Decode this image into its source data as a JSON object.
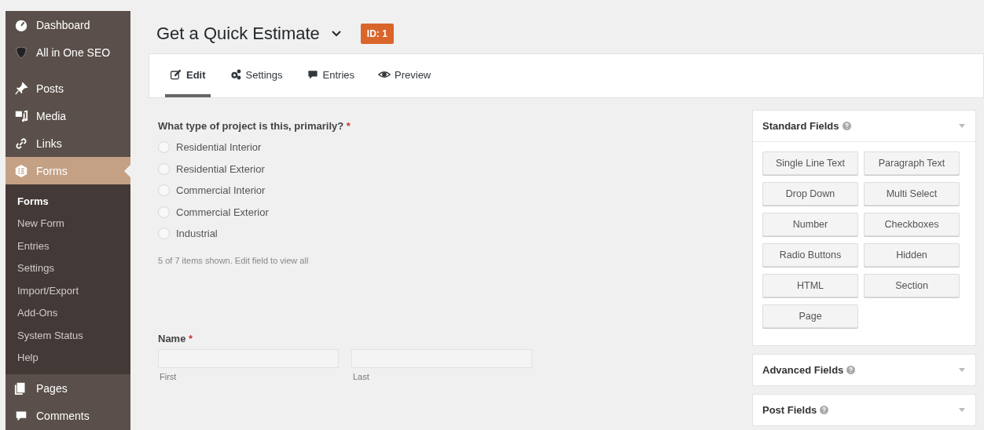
{
  "sidebar": {
    "items": [
      {
        "label": "Dashboard",
        "selected": false
      },
      {
        "label": "All in One SEO",
        "selected": false
      },
      {
        "label": "Posts",
        "selected": false
      },
      {
        "label": "Media",
        "selected": false
      },
      {
        "label": "Links",
        "selected": false
      },
      {
        "label": "Forms",
        "selected": true,
        "children": [
          {
            "label": "Forms",
            "selected": true
          },
          {
            "label": "New Form",
            "selected": false
          },
          {
            "label": "Entries",
            "selected": false
          },
          {
            "label": "Settings",
            "selected": false
          },
          {
            "label": "Import/Export",
            "selected": false
          },
          {
            "label": "Add-Ons",
            "selected": false
          },
          {
            "label": "System Status",
            "selected": false
          },
          {
            "label": "Help",
            "selected": false
          }
        ]
      },
      {
        "label": "Pages",
        "selected": false
      },
      {
        "label": "Comments",
        "selected": false
      }
    ]
  },
  "header": {
    "title": "Get a Quick Estimate",
    "badge": "ID: 1"
  },
  "tabs": [
    {
      "label": "Edit",
      "selected": true
    },
    {
      "label": "Settings",
      "selected": false
    },
    {
      "label": "Entries",
      "selected": false
    },
    {
      "label": "Preview",
      "selected": false
    }
  ],
  "form": {
    "question": {
      "label": "What type of project is this, primarily?",
      "required": "*",
      "options": [
        {
          "label": "Residential Interior",
          "selected": false
        },
        {
          "label": "Residential Exterior",
          "selected": false
        },
        {
          "label": "Commercial Interior",
          "selected": false
        },
        {
          "label": "Commercial Exterior",
          "selected": false
        },
        {
          "label": "Industrial",
          "selected": false
        }
      ],
      "note": "5 of 7 items shown. Edit field to view all"
    },
    "name": {
      "label": "Name",
      "required": "*",
      "fields": [
        {
          "sublabel": "First"
        },
        {
          "sublabel": "Last"
        }
      ]
    }
  },
  "panels": [
    {
      "title": "Standard Fields",
      "buttons": [
        "Single Line Text",
        "Paragraph Text",
        "Drop Down",
        "Multi Select",
        "Number",
        "Checkboxes",
        "Radio Buttons",
        "Hidden",
        "HTML",
        "Section",
        "Page"
      ]
    },
    {
      "title": "Advanced Fields"
    },
    {
      "title": "Post Fields"
    }
  ]
}
